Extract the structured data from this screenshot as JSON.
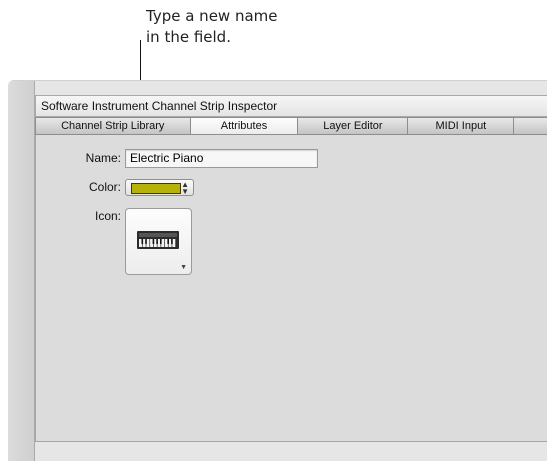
{
  "callout": {
    "line1": "Type a new name",
    "line2": "in the field."
  },
  "inspector": {
    "title": "Software Instrument Channel Strip Inspector",
    "tabs": [
      {
        "label": "Channel Strip Library"
      },
      {
        "label": "Attributes"
      },
      {
        "label": "Layer Editor"
      },
      {
        "label": "MIDI Input"
      }
    ],
    "active_tab": "Attributes"
  },
  "attributes": {
    "name_label": "Name:",
    "name_value": "Electric Piano",
    "color_label": "Color:",
    "color_value": "#b7b20a",
    "icon_label": "Icon:",
    "icon_name": "electric-piano-icon"
  }
}
